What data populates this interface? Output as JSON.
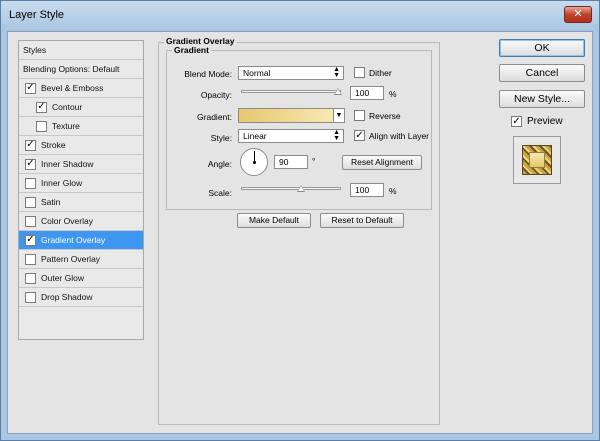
{
  "window": {
    "title": "Layer Style",
    "close_glyph": "✕"
  },
  "sidebar": {
    "header": "Styles",
    "blending": "Blending Options: Default",
    "items": [
      {
        "label": "Bevel & Emboss",
        "checked": true,
        "indent": false
      },
      {
        "label": "Contour",
        "checked": true,
        "indent": true
      },
      {
        "label": "Texture",
        "checked": false,
        "indent": true
      },
      {
        "label": "Stroke",
        "checked": true,
        "indent": false
      },
      {
        "label": "Inner Shadow",
        "checked": true,
        "indent": false
      },
      {
        "label": "Inner Glow",
        "checked": false,
        "indent": false
      },
      {
        "label": "Satin",
        "checked": false,
        "indent": false
      },
      {
        "label": "Color Overlay",
        "checked": false,
        "indent": false
      },
      {
        "label": "Gradient Overlay",
        "checked": true,
        "indent": false,
        "selected": true
      },
      {
        "label": "Pattern Overlay",
        "checked": false,
        "indent": false
      },
      {
        "label": "Outer Glow",
        "checked": false,
        "indent": false
      },
      {
        "label": "Drop Shadow",
        "checked": false,
        "indent": false
      }
    ]
  },
  "panel": {
    "section_title": "Gradient Overlay",
    "group_title": "Gradient",
    "blend_mode_label": "Blend Mode:",
    "blend_mode_value": "Normal",
    "dither_label": "Dither",
    "opacity_label": "Opacity:",
    "opacity_value": "100",
    "percent": "%",
    "gradient_label": "Gradient:",
    "reverse_label": "Reverse",
    "style_label": "Style:",
    "style_value": "Linear",
    "align_label": "Align with Layer",
    "angle_label": "Angle:",
    "angle_value": "90",
    "degree": "°",
    "reset_alignment": "Reset Alignment",
    "scale_label": "Scale:",
    "scale_value": "100",
    "make_default": "Make Default",
    "reset_default": "Reset to Default"
  },
  "actions": {
    "ok": "OK",
    "cancel": "Cancel",
    "new_style": "New Style...",
    "preview_label": "Preview"
  },
  "check_glyph": "✓",
  "arrow_glyph": "▼"
}
